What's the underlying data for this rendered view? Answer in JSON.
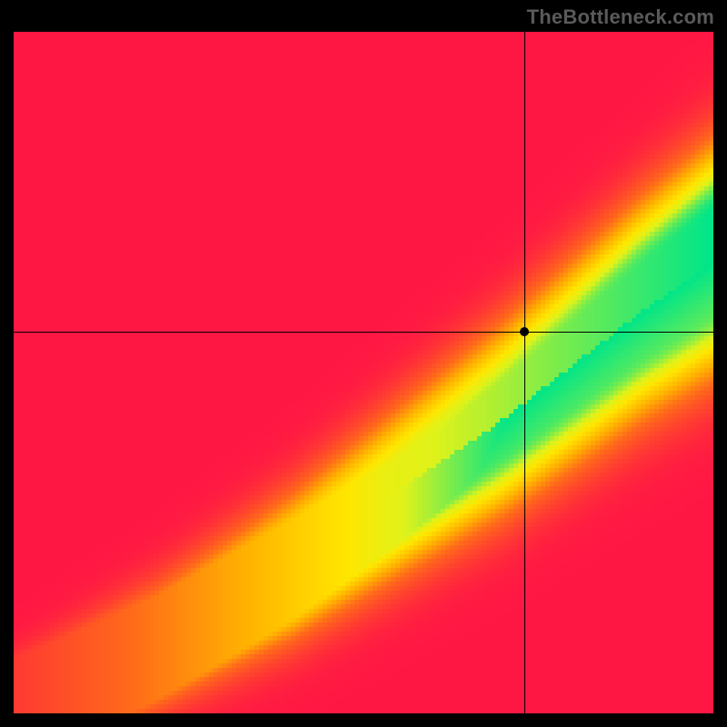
{
  "watermark": "TheBottleneck.com",
  "chart_data": {
    "type": "heatmap",
    "title": "",
    "xlabel": "",
    "ylabel": "",
    "xlim": [
      0,
      1
    ],
    "ylim": [
      0,
      1
    ],
    "crosshair": {
      "x": 0.73,
      "y": 0.56
    },
    "marker": {
      "x": 0.73,
      "y": 0.56
    },
    "optimal_band": {
      "description": "green band where y ≈ f(x); color = red→orange→yellow→green by closeness to band",
      "curve_points_xy": [
        [
          0.0,
          0.0
        ],
        [
          0.1,
          0.05
        ],
        [
          0.2,
          0.1
        ],
        [
          0.3,
          0.16
        ],
        [
          0.4,
          0.22
        ],
        [
          0.5,
          0.29
        ],
        [
          0.6,
          0.36
        ],
        [
          0.7,
          0.43
        ],
        [
          0.8,
          0.51
        ],
        [
          0.9,
          0.59
        ],
        [
          1.0,
          0.66
        ]
      ],
      "band_halfwidth_at_x": [
        [
          0.0,
          0.005
        ],
        [
          0.2,
          0.015
        ],
        [
          0.4,
          0.03
        ],
        [
          0.6,
          0.045
        ],
        [
          0.8,
          0.06
        ],
        [
          1.0,
          0.075
        ]
      ]
    },
    "color_scale": [
      {
        "stop": 0.0,
        "color": "#ff1744"
      },
      {
        "stop": 0.35,
        "color": "#ff6a1a"
      },
      {
        "stop": 0.55,
        "color": "#ffb300"
      },
      {
        "stop": 0.72,
        "color": "#ffe600"
      },
      {
        "stop": 0.82,
        "color": "#dff21a"
      },
      {
        "stop": 1.0,
        "color": "#00e589"
      }
    ],
    "grid": false,
    "legend": false
  }
}
